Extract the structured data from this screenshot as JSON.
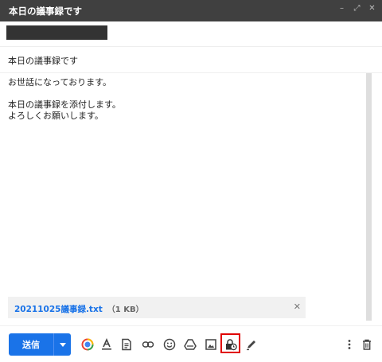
{
  "window": {
    "title": "本日の議事録です",
    "controls": [
      "minimize-icon",
      "expand-icon",
      "close-icon"
    ]
  },
  "recipient": {
    "value_redacted": true
  },
  "subject": "本日の議事録です",
  "body": {
    "lines": [
      "お世話になっております。",
      "",
      "本日の議事録を添付します。",
      "よろしくお願いします。"
    ]
  },
  "attachment": {
    "filename": "20211025議事録.txt",
    "size": "（1 KB）"
  },
  "toolbar": {
    "send_label": "送信",
    "icons": [
      "send-options-icon",
      "formatting-options-icon",
      "text-format-icon",
      "attach-file-icon",
      "insert-link-icon",
      "emoji-icon",
      "google-drive-icon",
      "insert-photo-icon",
      "confidential-mode-icon",
      "signature-icon",
      "more-options-icon",
      "discard-draft-icon"
    ],
    "highlighted": "confidential-mode-icon"
  },
  "colors": {
    "title_bar": "#404040",
    "send_button": "#1a73e8",
    "highlight": "#e00000",
    "attachment_link": "#1a73e8"
  }
}
